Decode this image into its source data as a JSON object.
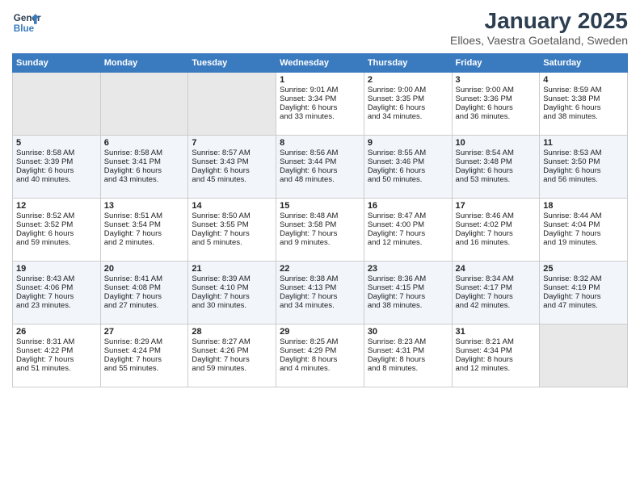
{
  "logo": {
    "text_general": "General",
    "text_blue": "Blue"
  },
  "title": "January 2025",
  "subtitle": "Elloes, Vaestra Goetaland, Sweden",
  "days_of_week": [
    "Sunday",
    "Monday",
    "Tuesday",
    "Wednesday",
    "Thursday",
    "Friday",
    "Saturday"
  ],
  "weeks": [
    [
      {
        "day": "",
        "info": ""
      },
      {
        "day": "",
        "info": ""
      },
      {
        "day": "",
        "info": ""
      },
      {
        "day": "1",
        "info": "Sunrise: 9:01 AM\nSunset: 3:34 PM\nDaylight: 6 hours\nand 33 minutes."
      },
      {
        "day": "2",
        "info": "Sunrise: 9:00 AM\nSunset: 3:35 PM\nDaylight: 6 hours\nand 34 minutes."
      },
      {
        "day": "3",
        "info": "Sunrise: 9:00 AM\nSunset: 3:36 PM\nDaylight: 6 hours\nand 36 minutes."
      },
      {
        "day": "4",
        "info": "Sunrise: 8:59 AM\nSunset: 3:38 PM\nDaylight: 6 hours\nand 38 minutes."
      }
    ],
    [
      {
        "day": "5",
        "info": "Sunrise: 8:58 AM\nSunset: 3:39 PM\nDaylight: 6 hours\nand 40 minutes."
      },
      {
        "day": "6",
        "info": "Sunrise: 8:58 AM\nSunset: 3:41 PM\nDaylight: 6 hours\nand 43 minutes."
      },
      {
        "day": "7",
        "info": "Sunrise: 8:57 AM\nSunset: 3:43 PM\nDaylight: 6 hours\nand 45 minutes."
      },
      {
        "day": "8",
        "info": "Sunrise: 8:56 AM\nSunset: 3:44 PM\nDaylight: 6 hours\nand 48 minutes."
      },
      {
        "day": "9",
        "info": "Sunrise: 8:55 AM\nSunset: 3:46 PM\nDaylight: 6 hours\nand 50 minutes."
      },
      {
        "day": "10",
        "info": "Sunrise: 8:54 AM\nSunset: 3:48 PM\nDaylight: 6 hours\nand 53 minutes."
      },
      {
        "day": "11",
        "info": "Sunrise: 8:53 AM\nSunset: 3:50 PM\nDaylight: 6 hours\nand 56 minutes."
      }
    ],
    [
      {
        "day": "12",
        "info": "Sunrise: 8:52 AM\nSunset: 3:52 PM\nDaylight: 6 hours\nand 59 minutes."
      },
      {
        "day": "13",
        "info": "Sunrise: 8:51 AM\nSunset: 3:54 PM\nDaylight: 7 hours\nand 2 minutes."
      },
      {
        "day": "14",
        "info": "Sunrise: 8:50 AM\nSunset: 3:55 PM\nDaylight: 7 hours\nand 5 minutes."
      },
      {
        "day": "15",
        "info": "Sunrise: 8:48 AM\nSunset: 3:58 PM\nDaylight: 7 hours\nand 9 minutes."
      },
      {
        "day": "16",
        "info": "Sunrise: 8:47 AM\nSunset: 4:00 PM\nDaylight: 7 hours\nand 12 minutes."
      },
      {
        "day": "17",
        "info": "Sunrise: 8:46 AM\nSunset: 4:02 PM\nDaylight: 7 hours\nand 16 minutes."
      },
      {
        "day": "18",
        "info": "Sunrise: 8:44 AM\nSunset: 4:04 PM\nDaylight: 7 hours\nand 19 minutes."
      }
    ],
    [
      {
        "day": "19",
        "info": "Sunrise: 8:43 AM\nSunset: 4:06 PM\nDaylight: 7 hours\nand 23 minutes."
      },
      {
        "day": "20",
        "info": "Sunrise: 8:41 AM\nSunset: 4:08 PM\nDaylight: 7 hours\nand 27 minutes."
      },
      {
        "day": "21",
        "info": "Sunrise: 8:39 AM\nSunset: 4:10 PM\nDaylight: 7 hours\nand 30 minutes."
      },
      {
        "day": "22",
        "info": "Sunrise: 8:38 AM\nSunset: 4:13 PM\nDaylight: 7 hours\nand 34 minutes."
      },
      {
        "day": "23",
        "info": "Sunrise: 8:36 AM\nSunset: 4:15 PM\nDaylight: 7 hours\nand 38 minutes."
      },
      {
        "day": "24",
        "info": "Sunrise: 8:34 AM\nSunset: 4:17 PM\nDaylight: 7 hours\nand 42 minutes."
      },
      {
        "day": "25",
        "info": "Sunrise: 8:32 AM\nSunset: 4:19 PM\nDaylight: 7 hours\nand 47 minutes."
      }
    ],
    [
      {
        "day": "26",
        "info": "Sunrise: 8:31 AM\nSunset: 4:22 PM\nDaylight: 7 hours\nand 51 minutes."
      },
      {
        "day": "27",
        "info": "Sunrise: 8:29 AM\nSunset: 4:24 PM\nDaylight: 7 hours\nand 55 minutes."
      },
      {
        "day": "28",
        "info": "Sunrise: 8:27 AM\nSunset: 4:26 PM\nDaylight: 7 hours\nand 59 minutes."
      },
      {
        "day": "29",
        "info": "Sunrise: 8:25 AM\nSunset: 4:29 PM\nDaylight: 8 hours\nand 4 minutes."
      },
      {
        "day": "30",
        "info": "Sunrise: 8:23 AM\nSunset: 4:31 PM\nDaylight: 8 hours\nand 8 minutes."
      },
      {
        "day": "31",
        "info": "Sunrise: 8:21 AM\nSunset: 4:34 PM\nDaylight: 8 hours\nand 12 minutes."
      },
      {
        "day": "",
        "info": ""
      }
    ]
  ]
}
